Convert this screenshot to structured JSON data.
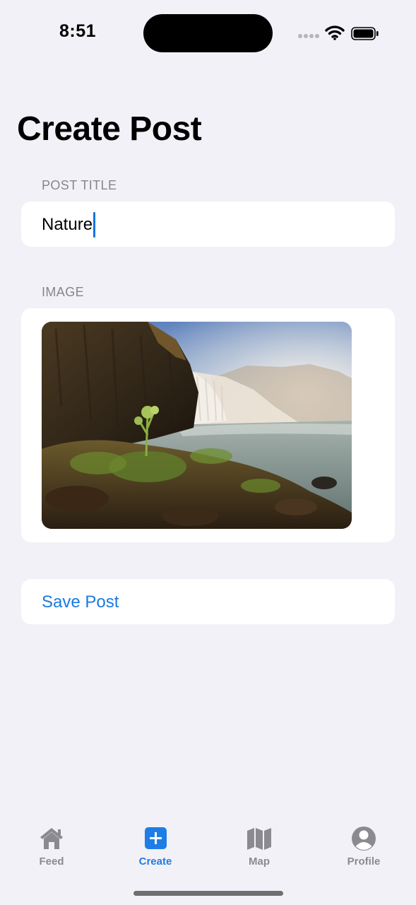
{
  "status_bar": {
    "time": "8:51"
  },
  "page": {
    "title": "Create Post"
  },
  "form": {
    "title_section_label": "POST TITLE",
    "title_value": "Nature",
    "image_section_label": "IMAGE"
  },
  "actions": {
    "save_label": "Save Post"
  },
  "tab_bar": {
    "items": [
      {
        "label": "Feed",
        "icon": "house-icon"
      },
      {
        "label": "Create",
        "icon": "plus-square-icon"
      },
      {
        "label": "Map",
        "icon": "map-icon"
      },
      {
        "label": "Profile",
        "icon": "person-circle-icon"
      }
    ],
    "active_index": 1
  },
  "colors": {
    "accent": "#1a7ae0",
    "background": "#f2f1f7",
    "inactive_tab": "#8b8a90"
  }
}
